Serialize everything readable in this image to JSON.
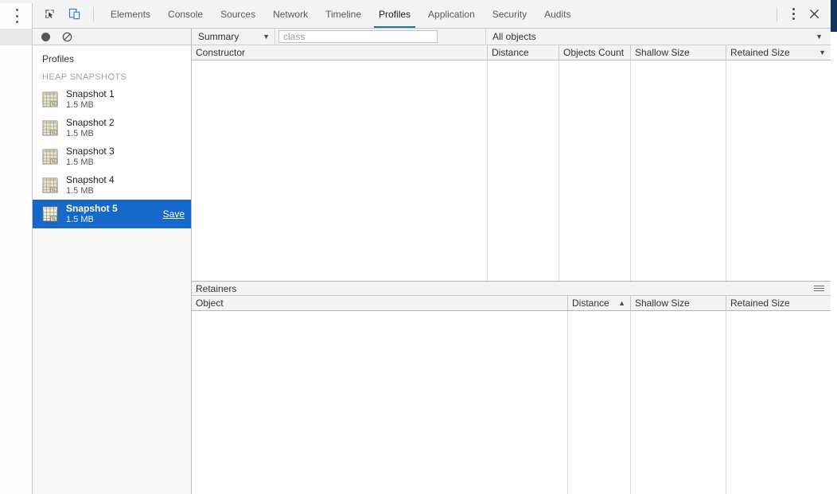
{
  "browser": {
    "menu_icon": "vertical-dots-icon"
  },
  "devtools": {
    "tools": [
      {
        "name": "inspect-element-icon",
        "title": "Inspect element"
      },
      {
        "name": "device-toolbar-icon",
        "title": "Toggle device toolbar"
      }
    ],
    "tabs": [
      {
        "label": "Elements",
        "active": false
      },
      {
        "label": "Console",
        "active": false
      },
      {
        "label": "Sources",
        "active": false
      },
      {
        "label": "Network",
        "active": false
      },
      {
        "label": "Timeline",
        "active": false
      },
      {
        "label": "Profiles",
        "active": true
      },
      {
        "label": "Application",
        "active": false
      },
      {
        "label": "Security",
        "active": false
      },
      {
        "label": "Audits",
        "active": false
      }
    ],
    "active_tab": "Profiles",
    "accent_color": "#1a73c8",
    "window_controls": {
      "more_label": "vertical-dots-icon",
      "close_label": "✕"
    }
  },
  "sidebar": {
    "toolbar": {
      "record_icon": "record-icon",
      "clear_icon": "clear-icon"
    },
    "title": "Profiles",
    "section_label": "HEAP SNAPSHOTS",
    "selected_color": "#1668c9",
    "items": [
      {
        "name": "Snapshot 1",
        "size": "1.5 MB",
        "selected": false,
        "action": ""
      },
      {
        "name": "Snapshot 2",
        "size": "1.5 MB",
        "selected": false,
        "action": ""
      },
      {
        "name": "Snapshot 3",
        "size": "1.5 MB",
        "selected": false,
        "action": ""
      },
      {
        "name": "Snapshot 4",
        "size": "1.5 MB",
        "selected": false,
        "action": ""
      },
      {
        "name": "Snapshot 5",
        "size": "1.5 MB",
        "selected": true,
        "action": "Save"
      }
    ]
  },
  "main": {
    "toolbar": {
      "view_select": "Summary",
      "filter_placeholder": "class",
      "filter_value": "",
      "objects_select": "All objects"
    },
    "constructors_grid": {
      "columns": [
        {
          "label": "Constructor",
          "sort": ""
        },
        {
          "label": "Distance",
          "sort": ""
        },
        {
          "label": "Objects Count",
          "sort": ""
        },
        {
          "label": "Shallow Size",
          "sort": ""
        },
        {
          "label": "Retained Size",
          "sort": "▼"
        }
      ],
      "rows": []
    },
    "retainers": {
      "title": "Retainers",
      "menu_icon": "hamburger-icon",
      "columns": [
        {
          "label": "Object",
          "sort": ""
        },
        {
          "label": "Distance",
          "sort": "▲"
        },
        {
          "label": "Shallow Size",
          "sort": ""
        },
        {
          "label": "Retained Size",
          "sort": ""
        }
      ],
      "rows": []
    }
  }
}
